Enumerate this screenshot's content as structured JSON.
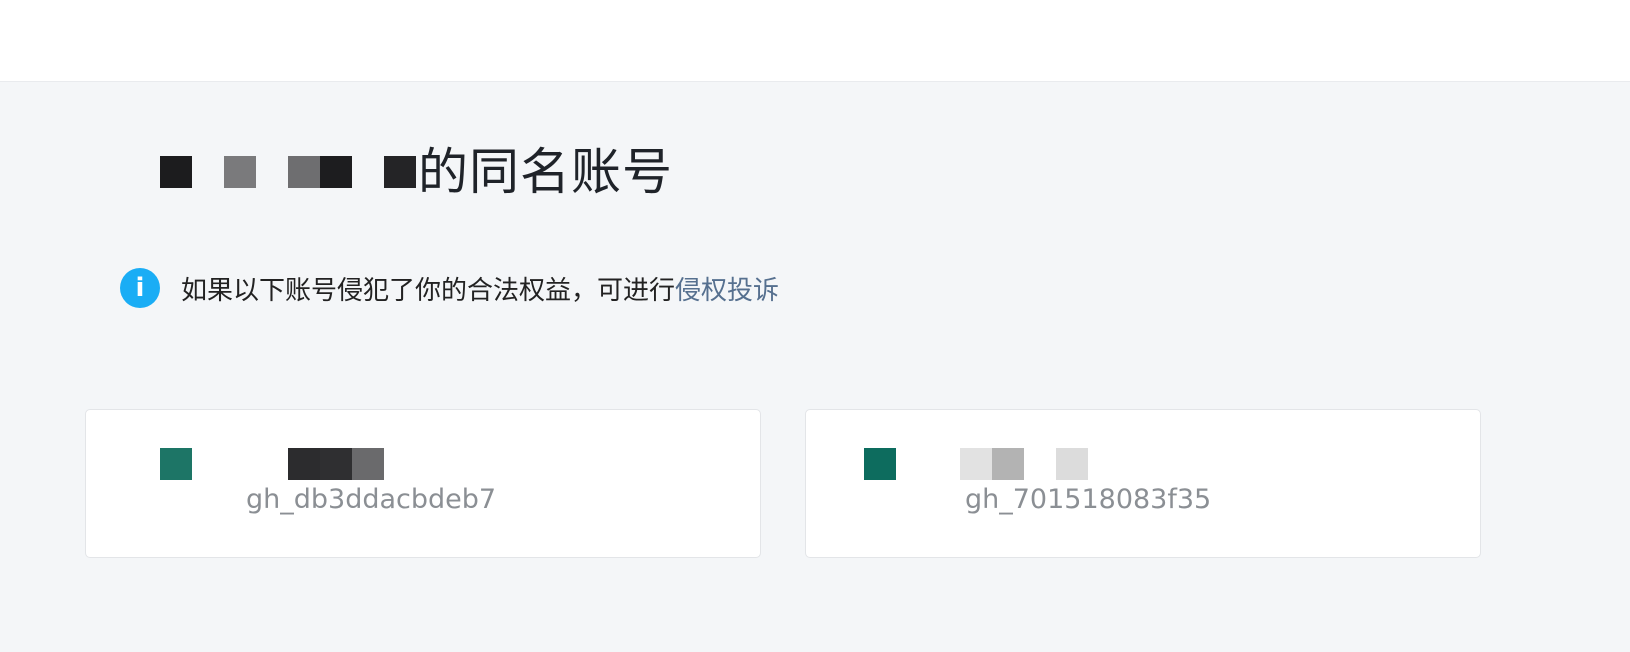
{
  "header": {},
  "title": {
    "suffix_text": "的同名账号"
  },
  "notice": {
    "icon": "info-icon",
    "icon_glyph": "i",
    "text": "如果以下账号侵犯了你的合法权益，可进行",
    "link_text": "侵权投诉"
  },
  "accounts": [
    {
      "id": "gh_db3ddacbdeb7",
      "avatar_color": "#1d7566"
    },
    {
      "id": "gh_701518083f35",
      "avatar_color": "#0d6c5e"
    }
  ],
  "colors": {
    "background": "#f4f6f8",
    "info_blue": "#1aadf5",
    "link": "#56708f",
    "title_text": "#1f2329",
    "id_text": "#8b8f94"
  }
}
